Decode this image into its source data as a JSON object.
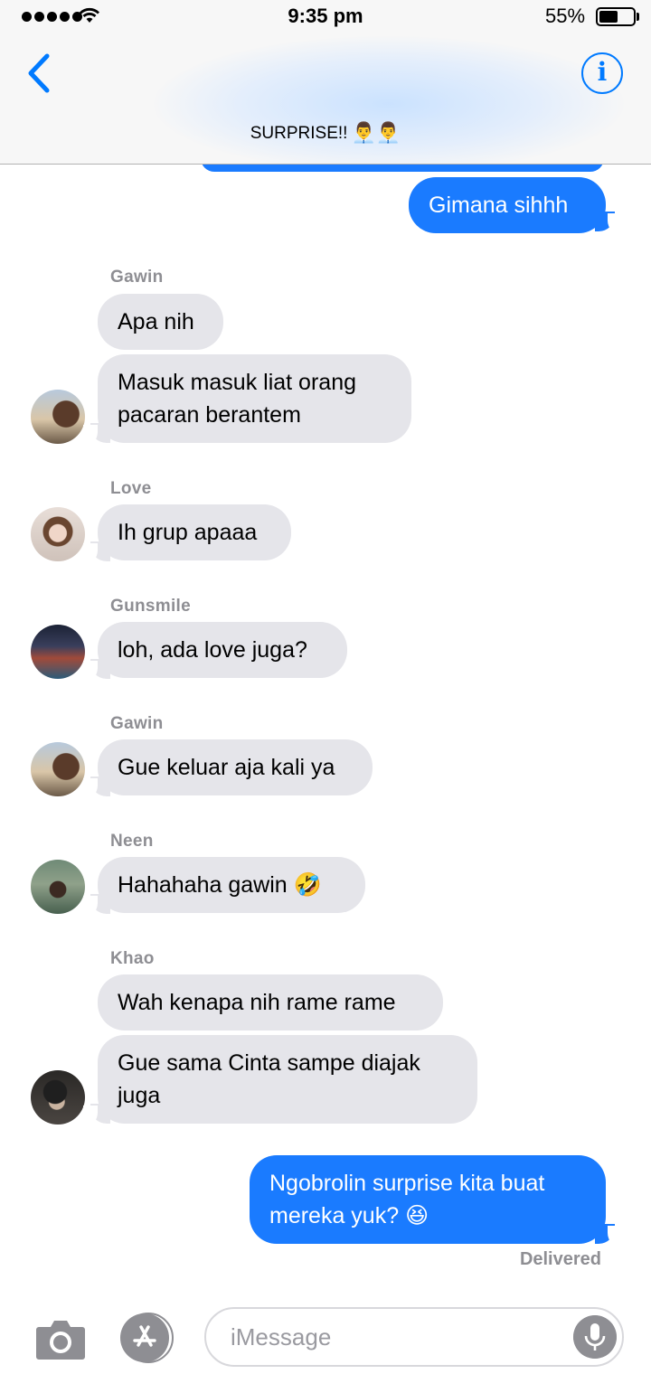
{
  "status_bar": {
    "time": "9:35 pm",
    "battery_percent_text": "55%",
    "battery_level": 0.55,
    "signal_bars": 5
  },
  "header": {
    "title": "SURPRISE!!",
    "title_emoji": "👨‍💼👨‍💼",
    "back_icon": "chevron-left-icon",
    "info_icon": "info-icon",
    "info_glyph": "i"
  },
  "messages": [
    {
      "id": "m1",
      "direction": "outgoing",
      "text": "Gimana sihhh"
    },
    {
      "id": "m2",
      "direction": "incoming",
      "sender": "Gawin",
      "text": "Apa nih"
    },
    {
      "id": "m3",
      "direction": "incoming",
      "sender": "Gawin",
      "text": "Masuk masuk liat orang pacaran berantem"
    },
    {
      "id": "m4",
      "direction": "incoming",
      "sender": "Love",
      "text": "Ih grup apaaa"
    },
    {
      "id": "m5",
      "direction": "incoming",
      "sender": "Gunsmile",
      "text": "loh, ada love juga?"
    },
    {
      "id": "m6",
      "direction": "incoming",
      "sender": "Gawin",
      "text": "Gue keluar aja kali ya"
    },
    {
      "id": "m7",
      "direction": "incoming",
      "sender": "Neen",
      "text": "Hahahaha gawin",
      "emoji": "🤣"
    },
    {
      "id": "m8",
      "direction": "incoming",
      "sender": "Khao",
      "text": "Wah kenapa nih rame rame"
    },
    {
      "id": "m9",
      "direction": "incoming",
      "sender": "Khao",
      "text": "Gue sama Cinta sampe diajak juga"
    },
    {
      "id": "m10",
      "direction": "outgoing",
      "text": "Ngobrolin surprise kita buat mereka yuk?",
      "emoji": "😆"
    }
  ],
  "delivered_label": "Delivered",
  "input_bar": {
    "placeholder": "iMessage",
    "camera_icon": "camera-icon",
    "apps_icon": "app-store-icon",
    "mic_icon": "microphone-icon"
  },
  "colors": {
    "accent": "#007aff",
    "outgoing_bubble": "#1a7bff",
    "incoming_bubble": "#e5e5ea",
    "secondary_text": "#8e8e93"
  }
}
